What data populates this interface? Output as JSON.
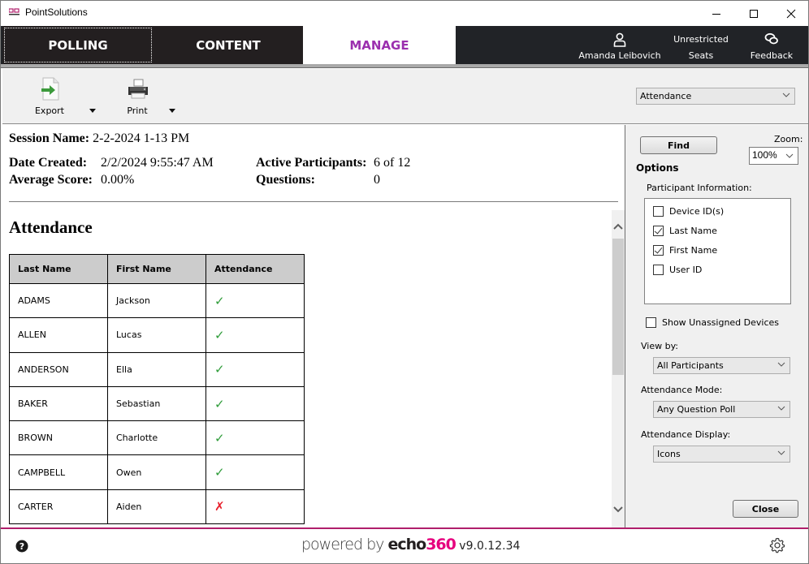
{
  "window": {
    "title": "PointSolutions",
    "controls": {
      "minimize": "minimize",
      "maximize": "maximize",
      "close": "close"
    }
  },
  "nav": {
    "tabs": [
      {
        "label": "POLLING",
        "active": false
      },
      {
        "label": "CONTENT",
        "active": false
      },
      {
        "label": "MANAGE",
        "active": true
      }
    ],
    "user": {
      "icon": "user-icon",
      "label": "Amanda Leibovich"
    },
    "seats": {
      "top": "Unrestricted",
      "bottom": "Seats"
    },
    "feedback": {
      "icon": "chat-bubbles-icon",
      "label": "Feedback"
    },
    "active_color": "#9b2fae"
  },
  "toolbar": {
    "export_label": "Export",
    "print_label": "Print",
    "report_select": "Attendance"
  },
  "report": {
    "session_name_label": "Session Name:",
    "session_name": "2-2-2024 1-13 PM",
    "date_created_label": "Date Created:",
    "date_created": "2/2/2024 9:55:47 AM",
    "average_score_label": "Average Score:",
    "average_score": "0.00%",
    "active_participants_label": "Active Participants:",
    "active_participants": "6 of 12",
    "questions_label": "Questions:",
    "questions": "0",
    "section_title": "Attendance",
    "table": {
      "headers": [
        "Last Name",
        "First Name",
        "Attendance"
      ],
      "rows": [
        {
          "last": "ADAMS",
          "first": "Jackson",
          "attended": true
        },
        {
          "last": "ALLEN",
          "first": "Lucas",
          "attended": true
        },
        {
          "last": "ANDERSON",
          "first": "Ella",
          "attended": true
        },
        {
          "last": "BAKER",
          "first": "Sebastian",
          "attended": true
        },
        {
          "last": "BROWN",
          "first": "Charlotte",
          "attended": true
        },
        {
          "last": "CAMPBELL",
          "first": "Owen",
          "attended": true
        },
        {
          "last": "CARTER",
          "first": "Aiden",
          "attended": false
        }
      ],
      "check_glyph": "✓",
      "cross_glyph": "✗",
      "check_color": "#2f9c3a",
      "cross_color": "#e8202c"
    }
  },
  "panel": {
    "find_label": "Find",
    "zoom_label": "Zoom:",
    "zoom_value": "100%",
    "options_title": "Options",
    "participant_info_label": "Participant Information:",
    "participant_fields": [
      {
        "label": "Device ID(s)",
        "checked": false
      },
      {
        "label": "Last Name",
        "checked": true
      },
      {
        "label": "First Name",
        "checked": true
      },
      {
        "label": "User ID",
        "checked": false
      }
    ],
    "show_unassigned_label": "Show Unassigned Devices",
    "show_unassigned_checked": false,
    "view_by_label": "View by:",
    "view_by_value": "All Participants",
    "attendance_mode_label": "Attendance Mode:",
    "attendance_mode_value": "Any Question Poll",
    "attendance_display_label": "Attendance Display:",
    "attendance_display_value": "Icons",
    "close_label": "Close"
  },
  "footer": {
    "powered_by": "powered by ",
    "brand_echo": "echo",
    "brand_360": "360",
    "version": " v9.0.12.34",
    "brand_color": "#e6007e"
  }
}
